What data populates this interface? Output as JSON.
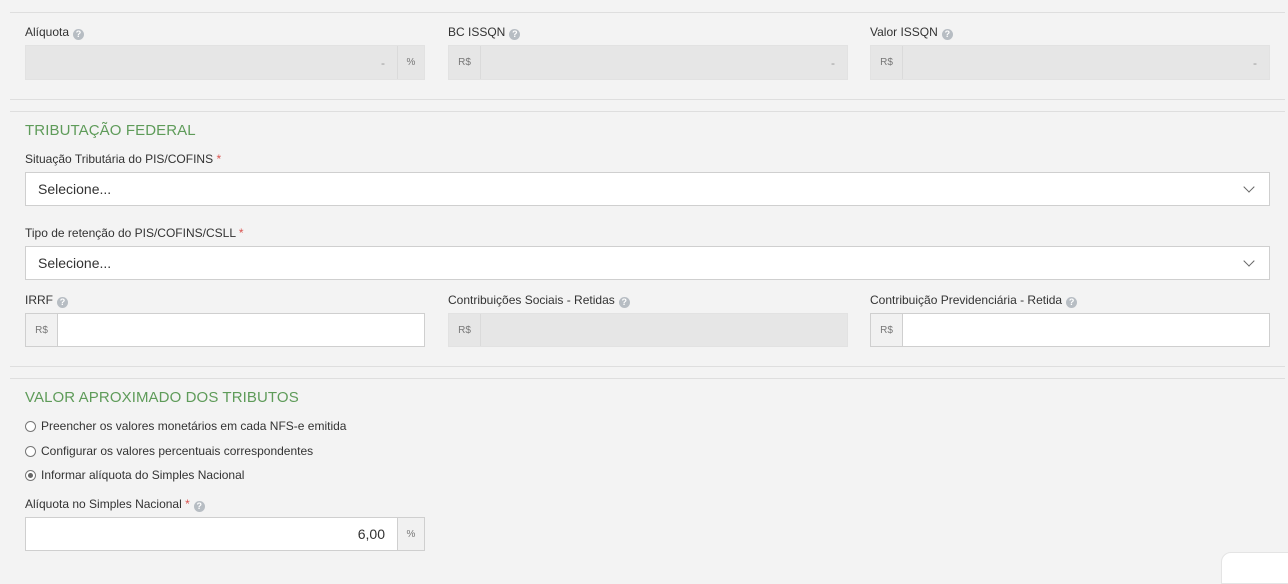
{
  "issqn": {
    "aliquota": {
      "label": "Alíquota",
      "value": "-",
      "suffix": "%"
    },
    "bc": {
      "label": "BC ISSQN",
      "prefix": "R$",
      "value": "-"
    },
    "valor": {
      "label": "Valor ISSQN",
      "prefix": "R$",
      "value": "-"
    }
  },
  "federal": {
    "title": "TRIBUTAÇÃO FEDERAL",
    "pis_cofins": {
      "label": "Situação Tributária do PIS/COFINS",
      "required": "*",
      "value": "Selecione..."
    },
    "retencao": {
      "label": "Tipo de retenção do PIS/COFINS/CSLL",
      "required": "*",
      "value": "Selecione..."
    },
    "irrf": {
      "label": "IRRF",
      "prefix": "R$",
      "value": ""
    },
    "contrib_sociais": {
      "label": "Contribuições Sociais - Retidas",
      "prefix": "R$",
      "value": ""
    },
    "contrib_prev": {
      "label": "Contribuição Previdenciária - Retida",
      "prefix": "R$",
      "value": ""
    }
  },
  "aproximado": {
    "title": "VALOR APROXIMADO DOS TRIBUTOS",
    "options": [
      {
        "label": "Preencher os valores monetários em cada NFS-e emitida",
        "checked": false
      },
      {
        "label": "Configurar os valores percentuais correspondentes",
        "checked": false
      },
      {
        "label": "Informar alíquota do Simples Nacional",
        "checked": true
      }
    ],
    "simples": {
      "label": "Alíquota no Simples Nacional",
      "required": "*",
      "value": "6,00",
      "suffix": "%"
    }
  },
  "icons": {
    "help": "question-circle-icon",
    "chevron": "chevron-down-icon"
  },
  "colors": {
    "section_title": "#5e9b59",
    "required": "#d9534f",
    "disabled_bg": "#e6e6e6"
  }
}
